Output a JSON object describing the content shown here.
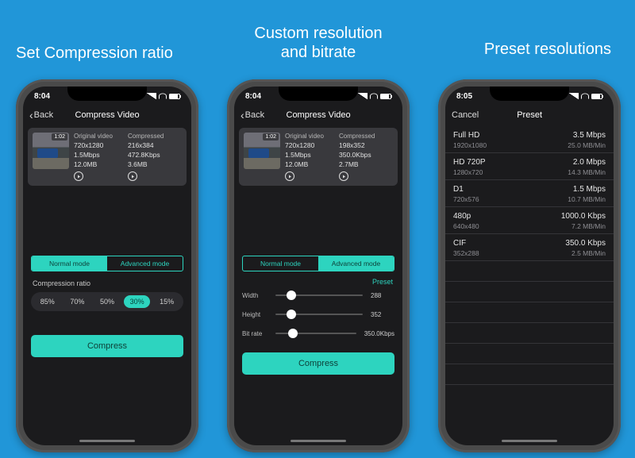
{
  "titles": {
    "t1": "Set Compression ratio",
    "t2_l1": "Custom resolution",
    "t2_l2": "and bitrate",
    "t3": "Preset resolutions"
  },
  "status": {
    "time1": "8:04",
    "time2": "8:04",
    "time3": "8:05"
  },
  "nav": {
    "back": "Back",
    "title": "Compress Video",
    "cancel": "Cancel",
    "preset_title": "Preset"
  },
  "card": {
    "duration": "1:02",
    "original_head": "Original video",
    "compressed_head": "Compressed",
    "original": {
      "res": "720x1280",
      "bitrate": "1.5Mbps",
      "size": "12.0MB"
    },
    "p1_compressed": {
      "res": "216x384",
      "bitrate": "472.8Kbps",
      "size": "3.6MB"
    },
    "p2_compressed": {
      "res": "198x352",
      "bitrate": "350.0Kbps",
      "size": "2.7MB"
    }
  },
  "segments": {
    "normal": "Normal mode",
    "advanced": "Advanced mode"
  },
  "ratio": {
    "label": "Compression ratio",
    "options": [
      "85%",
      "70%",
      "50%",
      "30%",
      "15%"
    ],
    "selected": "30%"
  },
  "compress_label": "Compress",
  "advanced": {
    "preset_link": "Preset",
    "width_label": "Width",
    "width_value": "288",
    "height_label": "Height",
    "height_value": "352",
    "bitrate_label": "Bit rate",
    "bitrate_value": "350.0Kbps"
  },
  "presets": [
    {
      "name": "Full HD",
      "bitrate": "3.5 Mbps",
      "res": "1920x1080",
      "rate": "25.0 MB/Min"
    },
    {
      "name": "HD 720P",
      "bitrate": "2.0 Mbps",
      "res": "1280x720",
      "rate": "14.3 MB/Min"
    },
    {
      "name": "D1",
      "bitrate": "1.5 Mbps",
      "res": "720x576",
      "rate": "10.7 MB/Min"
    },
    {
      "name": "480p",
      "bitrate": "1000.0 Kbps",
      "res": "640x480",
      "rate": "7.2 MB/Min"
    },
    {
      "name": "CIF",
      "bitrate": "350.0 Kbps",
      "res": "352x288",
      "rate": "2.5 MB/Min"
    }
  ]
}
